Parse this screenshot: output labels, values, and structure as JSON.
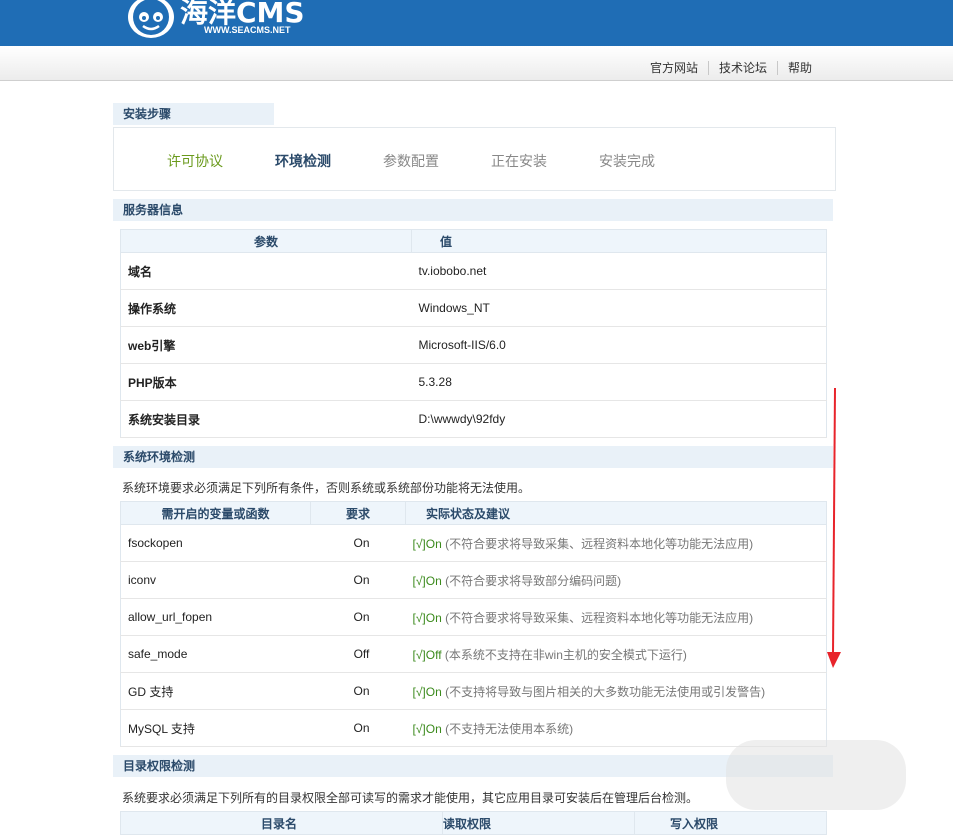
{
  "header": {
    "logo_text": "海洋CMS",
    "logo_url_text": "WWW.SEACMS.NET",
    "brand_color": "#1f6db5"
  },
  "topnav": {
    "links": [
      "官方网站",
      "技术论坛",
      "帮助"
    ]
  },
  "install_steps": {
    "title": "安装步骤",
    "steps": [
      {
        "label": "许可协议",
        "state": "done"
      },
      {
        "label": "环境检测",
        "state": "active"
      },
      {
        "label": "参数配置",
        "state": "pending"
      },
      {
        "label": "正在安装",
        "state": "pending"
      },
      {
        "label": "安装完成",
        "state": "pending"
      }
    ]
  },
  "server_info": {
    "title": "服务器信息",
    "headers": [
      "参数",
      "值"
    ],
    "rows": [
      {
        "param": "域名",
        "value": "tv.iobobo.net"
      },
      {
        "param": "操作系统",
        "value": "Windows_NT"
      },
      {
        "param": "web引擎",
        "value": "Microsoft-IIS/6.0"
      },
      {
        "param": "PHP版本",
        "value": "5.3.28"
      },
      {
        "param": "系统安装目录",
        "value": "D:\\wwwdy\\92fdy"
      }
    ]
  },
  "env_check": {
    "title": "系统环境检测",
    "description": "系统环境要求必须满足下列所有条件，否则系统或系统部份功能将无法使用。",
    "headers": [
      "需开启的变量或函数",
      "要求",
      "实际状态及建议"
    ],
    "rows": [
      {
        "name": "fsockopen",
        "req": "On",
        "status": "[√]On",
        "note": " (不符合要求将导致采集、远程资料本地化等功能无法应用)"
      },
      {
        "name": "iconv",
        "req": "On",
        "status": "[√]On",
        "note": " (不符合要求将导致部分编码问题)"
      },
      {
        "name": "allow_url_fopen",
        "req": "On",
        "status": "[√]On",
        "note": " (不符合要求将导致采集、远程资料本地化等功能无法应用)"
      },
      {
        "name": "safe_mode",
        "req": "Off",
        "status": "[√]Off",
        "note": " (本系统不支持在非win主机的安全模式下运行)"
      },
      {
        "name": "GD 支持",
        "req": "On",
        "status": "[√]On",
        "note": " (不支持将导致与图片相关的大多数功能无法使用或引发警告)"
      },
      {
        "name": "MySQL 支持",
        "req": "On",
        "status": "[√]On",
        "note": " (不支持无法使用本系统)"
      }
    ]
  },
  "dir_check": {
    "title": "目录权限检测",
    "description": "系统要求必须满足下列所有的目录权限全部可读写的需求才能使用，其它应用目录可安装后在管理后台检测。",
    "headers": [
      "目录名",
      "读取权限",
      "写入权限"
    ]
  },
  "colors": {
    "ok": "#3b8a1c",
    "arrow": "#e8242b"
  }
}
